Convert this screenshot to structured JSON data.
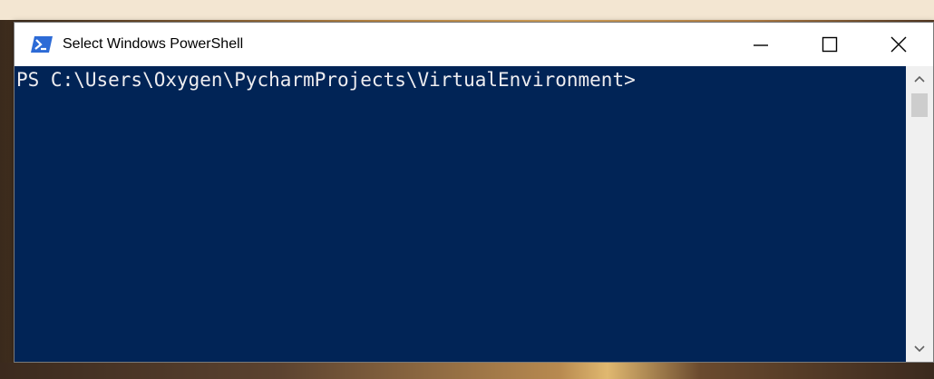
{
  "window": {
    "title": "Select Windows PowerShell",
    "icon": "powershell-icon",
    "controls": {
      "minimize": "minimize-icon",
      "maximize": "maximize-icon",
      "close": "close-icon"
    }
  },
  "console": {
    "prompt": "PS C:\\Users\\Oxygen\\PycharmProjects\\VirtualEnvironment>",
    "background_color": "#012456",
    "text_color": "#eeedf0"
  },
  "scrollbar": {
    "up_icon": "chevron-up-icon",
    "down_icon": "chevron-down-icon"
  }
}
